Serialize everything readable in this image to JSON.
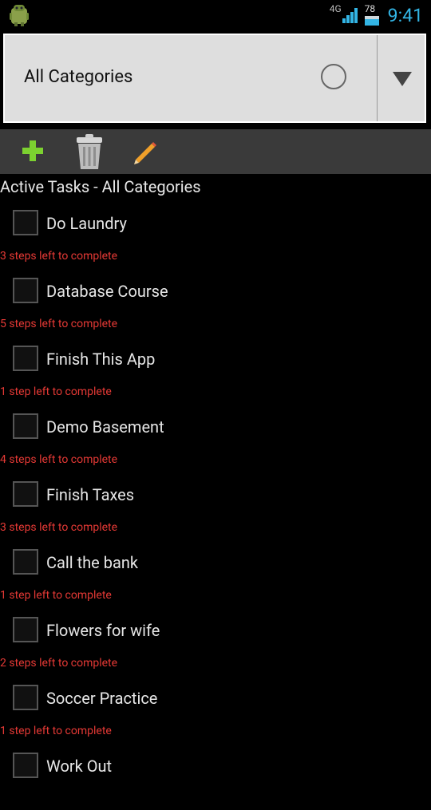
{
  "status_bar": {
    "app_icon": "android-icon",
    "network": "4G",
    "battery_level": "78",
    "time": "9:41"
  },
  "category_spinner": {
    "selected": "All Categories"
  },
  "toolbar": {
    "icons": [
      "add-icon",
      "trash-icon",
      "pencil-icon"
    ]
  },
  "section_title": "Active Tasks - All Categories",
  "tasks": [
    {
      "name": "Do Laundry",
      "steps": "3 steps left to complete"
    },
    {
      "name": "Database Course",
      "steps": "5 steps left to complete"
    },
    {
      "name": "Finish This App",
      "steps": "1 step left to complete"
    },
    {
      "name": "Demo Basement",
      "steps": "4 steps left to complete"
    },
    {
      "name": "Finish Taxes",
      "steps": "3 steps left to complete"
    },
    {
      "name": "Call the bank",
      "steps": "1 step left to complete"
    },
    {
      "name": "Flowers for wife",
      "steps": "2 steps left to complete"
    },
    {
      "name": "Soccer Practice",
      "steps": "1 step left to complete"
    },
    {
      "name": "Work Out",
      "steps": ""
    }
  ],
  "colors": {
    "accent_time": "#33b5e5",
    "steps_text": "#e53935",
    "spinner_bg": "#dedede",
    "toolbar_bg": "#3a3a3a"
  }
}
